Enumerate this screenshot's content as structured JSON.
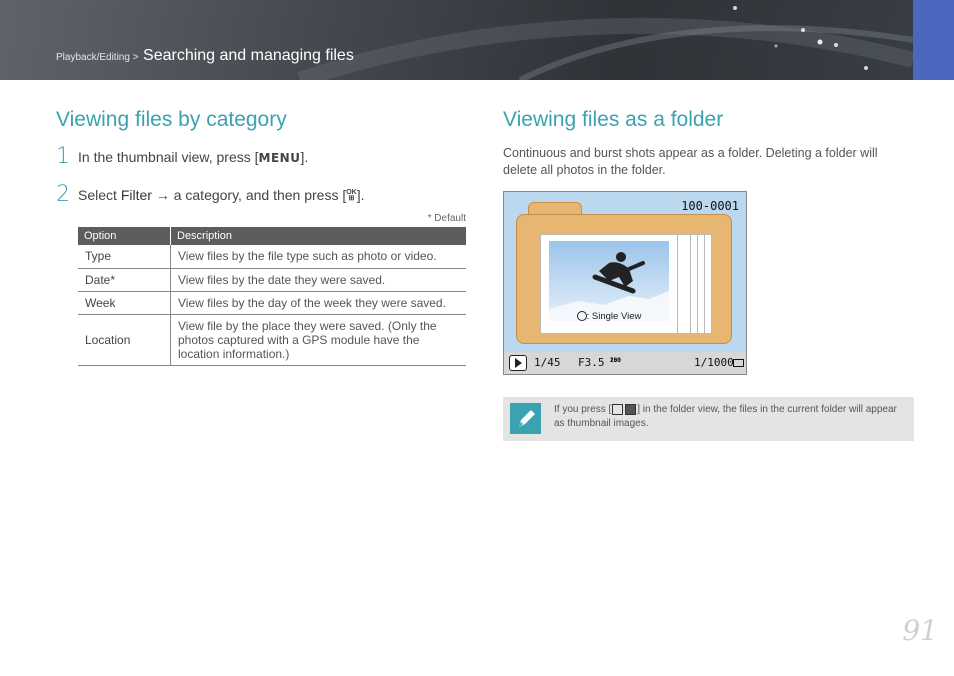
{
  "header": {
    "breadcrumb_small": "Playback/Editing >",
    "breadcrumb_main": "Searching and managing files"
  },
  "left": {
    "title": "Viewing files by category",
    "step1": {
      "num": "1",
      "text_before": "In the thumbnail view, press [",
      "key": "MENU",
      "text_after": "]."
    },
    "step2": {
      "num": "2",
      "text_before": "Select ",
      "bold": "Filter",
      "text_mid": " → a category, and then press [",
      "key_top": "OK",
      "key_bottom": "⊞",
      "text_after": "]."
    },
    "default_note": "* Default",
    "table": {
      "headers": [
        "Option",
        "Description"
      ],
      "rows": [
        {
          "option": "Type",
          "description": "View files by the file type such as photo or video."
        },
        {
          "option": "Date*",
          "description": "View files by the date they were saved."
        },
        {
          "option": "Week",
          "description": "View files by the day of the week they were saved."
        },
        {
          "option": "Location",
          "description": "View file by the place they were saved. (Only the photos captured with a GPS module have the location information.)"
        }
      ]
    }
  },
  "right": {
    "title": "Viewing files as a folder",
    "paragraph": "Continuous and  burst shots appear as a folder. Deleting a folder will delete all photos in the folder.",
    "screen": {
      "counter": "100-0001",
      "single_view": ": Single View",
      "shutter_count": "1/45",
      "aperture": "F3.5",
      "iso_top": "ISO",
      "iso_bottom": "200",
      "speed": "1/1000"
    },
    "note": {
      "text_before": "If you press [",
      "text_after": "] in the folder view, the files in the current folder will appear as thumbnail images."
    }
  },
  "page_number": "91",
  "colors": {
    "accent": "#3aa2b1",
    "header_tab": "#4a68c0"
  }
}
